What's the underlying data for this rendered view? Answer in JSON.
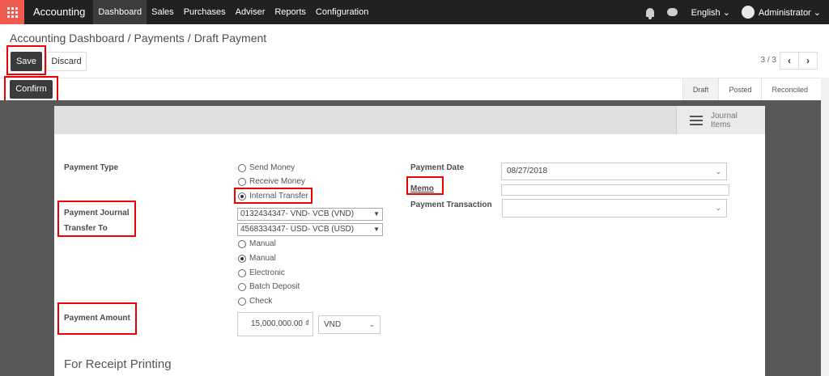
{
  "navbar": {
    "brand": "Accounting",
    "menu": [
      "Dashboard",
      "Sales",
      "Purchases",
      "Adviser",
      "Reports",
      "Configuration"
    ],
    "language": "English ⌄",
    "user": "Administrator ⌄"
  },
  "breadcrumb": {
    "items": [
      "Accounting Dashboard",
      "Payments",
      "Draft Payment"
    ],
    "separator": "/"
  },
  "buttons": {
    "save": "Save",
    "discard": "Discard",
    "confirm": "Confirm"
  },
  "pager": {
    "text": "3 / 3",
    "prev": "‹",
    "next": "›"
  },
  "status": {
    "steps": [
      "Draft",
      "Posted",
      "Reconciled"
    ],
    "current": "Draft"
  },
  "journal_items": "Journal Items",
  "form": {
    "payment_type_label": "Payment Type",
    "payment_types": [
      "Send Money",
      "Receive Money",
      "Internal Transfer"
    ],
    "payment_type_selected": "Internal Transfer",
    "payment_journal_label": "Payment Journal",
    "payment_journal_value": "0132434347- VND- VCB (VND)",
    "transfer_to_label": "Transfer To",
    "transfer_to_value": "4568334347- USD- VCB (USD)",
    "methods": [
      "Manual",
      "Manual",
      "Electronic",
      "Batch Deposit",
      "Check"
    ],
    "method_selected_index": 1,
    "payment_amount_label": "Payment Amount",
    "payment_amount_value": "15,000,000.00",
    "currency_symbol": "₫",
    "currency": "VND",
    "payment_date_label": "Payment Date",
    "payment_date_value": "08/27/2018",
    "memo_label": "Memo",
    "memo_value": "",
    "payment_transaction_label": "Payment Transaction",
    "payment_transaction_value": "",
    "receipt_section": "For Receipt Printing"
  },
  "colors": {
    "navbar": "#212121",
    "apps": "#f05a4f",
    "highlight": "#e00000",
    "primary_button": "#3b3b3b"
  }
}
